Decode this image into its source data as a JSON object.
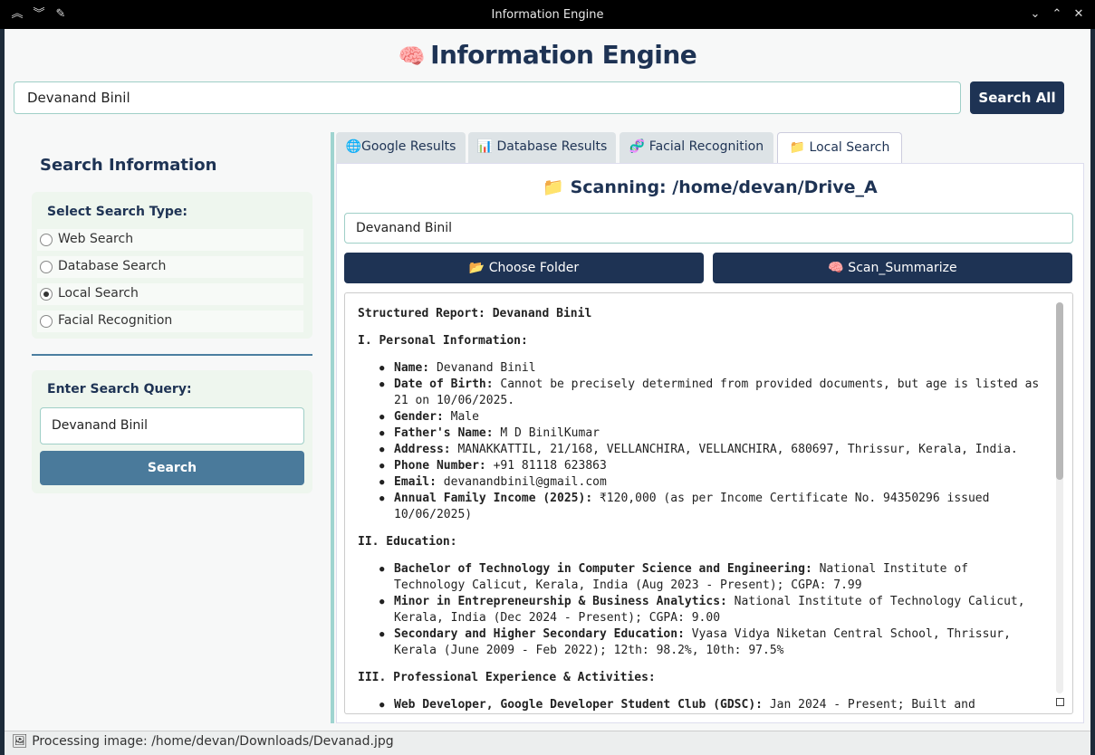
{
  "window": {
    "title": "Information Engine"
  },
  "app": {
    "title": "Information Engine",
    "brain_icon": "🧠"
  },
  "main_search": {
    "value": "Devanand Binil",
    "button": "Search All"
  },
  "sidebar": {
    "title": "Search Information",
    "type_label": "Select Search Type:",
    "options": [
      {
        "label": "Web Search",
        "selected": false
      },
      {
        "label": "Database Search",
        "selected": false
      },
      {
        "label": "Local Search",
        "selected": true
      },
      {
        "label": "Facial Recognition",
        "selected": false
      }
    ],
    "query_label": "Enter Search Query:",
    "query_value": "Devanand Binil",
    "search_button": "Search"
  },
  "tabs": [
    {
      "icon": "🌐",
      "label": "Google Results"
    },
    {
      "icon": "📊",
      "label": "Database Results"
    },
    {
      "icon": "🧬",
      "label": "Facial Recognition"
    },
    {
      "icon": "📁",
      "label": "Local Search"
    }
  ],
  "local": {
    "scan_icon": "📁",
    "scan_title": "Scanning: /home/devan/Drive_A",
    "input_value": "Devanand Binil",
    "choose_folder": "📂 Choose Folder",
    "scan_summarize": "🧠 Scan_Summarize"
  },
  "report": {
    "title": "Structured Report: Devanand Binil",
    "sec1": "I. Personal Information:",
    "personal": [
      {
        "k": "Name:",
        "v": " Devanand Binil"
      },
      {
        "k": "Date of Birth:",
        "v": " Cannot be precisely determined from provided documents, but age is listed as 21 on 10/06/2025."
      },
      {
        "k": "Gender:",
        "v": " Male"
      },
      {
        "k": "Father's Name:",
        "v": " M D BinilKumar"
      },
      {
        "k": "Address:",
        "v": " MANAKKATTIL, 21/168, VELLANCHIRA, VELLANCHIRA, 680697, Thrissur, Kerala, India."
      },
      {
        "k": "Phone Number:",
        "v": " +91 81118 623863"
      },
      {
        "k": "Email:",
        "v": " devanandbinil@gmail.com"
      },
      {
        "k": "Annual Family Income (2025):",
        "v": " ₹120,000 (as per Income Certificate No. 94350296 issued 10/06/2025)"
      }
    ],
    "sec2": "II. Education:",
    "education": [
      {
        "k": "Bachelor of Technology in Computer Science and Engineering:",
        "v": " National Institute of Technology Calicut, Kerala, India (Aug 2023 - Present); CGPA: 7.99"
      },
      {
        "k": "Minor in Entrepreneurship & Business Analytics:",
        "v": " National Institute of Technology Calicut, Kerala, India (Dec 2024 - Present); CGPA: 9.00"
      },
      {
        "k": "Secondary and Higher Secondary Education:",
        "v": " Vyasa Vidya Niketan Central School, Thrissur, Kerala (June 2009 - Feb 2022); 12th: 98.2%, 10th: 97.5%"
      }
    ],
    "sec3": "III. Professional Experience & Activities:",
    "experience": [
      {
        "k": "Web Developer, Google Developer Student Club (GDSC):",
        "v": " Jan 2024 - Present; Built and"
      }
    ]
  },
  "status": {
    "icon": "🖼",
    "text": "Processing image: /home/devan/Downloads/Devanad.jpg"
  }
}
